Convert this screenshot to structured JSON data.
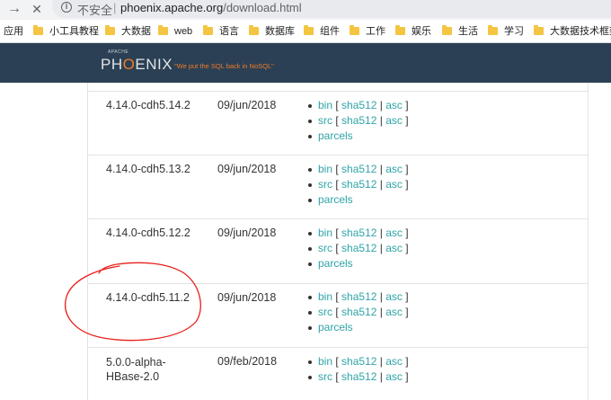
{
  "browser": {
    "back_icon": "→",
    "close_icon": "✕",
    "security_label": "不安全",
    "separator": "|",
    "url_domain": "phoenix.apache.org",
    "url_path": "/download.html"
  },
  "bookmarks": [
    {
      "label": "应用",
      "folder": false
    },
    {
      "label": "小工具教程",
      "folder": true
    },
    {
      "label": "大数据",
      "folder": true
    },
    {
      "label": "web",
      "folder": true
    },
    {
      "label": "语言",
      "folder": true
    },
    {
      "label": "数据库",
      "folder": true
    },
    {
      "label": "组件",
      "folder": true
    },
    {
      "label": "工作",
      "folder": true
    },
    {
      "label": "娱乐",
      "folder": true
    },
    {
      "label": "生活",
      "folder": true
    },
    {
      "label": "学习",
      "folder": true
    },
    {
      "label": "大数据技术框架",
      "folder": true
    }
  ],
  "site": {
    "logo_small": "APACHE",
    "logo_pre": "PH",
    "logo_o": "O",
    "logo_post": "ENIX",
    "tagline": "\"We put the SQL back in NoSQL\""
  },
  "releases": [
    {
      "version": "4.14.0-cdh5.14.2",
      "date": "09/jun/2018"
    },
    {
      "version": "4.14.0-cdh5.13.2",
      "date": "09/jun/2018"
    },
    {
      "version": "4.14.0-cdh5.12.2",
      "date": "09/jun/2018"
    },
    {
      "version": "4.14.0-cdh5.11.2",
      "date": "09/jun/2018"
    },
    {
      "version": "5.0.0-alpha-HBase-2.0",
      "date": "09/feb/2018"
    }
  ],
  "link_labels": {
    "bin": "bin",
    "src": "src",
    "sha512": "sha512",
    "asc": "asc",
    "parcels": "parcels",
    "open_bracket": "[",
    "close_bracket": "]",
    "pipe": "|"
  },
  "colors": {
    "header_bg": "#2b4054",
    "link": "#2fa4a8",
    "brand_orange": "#f07b2a",
    "annotation_red": "#e8201a"
  }
}
